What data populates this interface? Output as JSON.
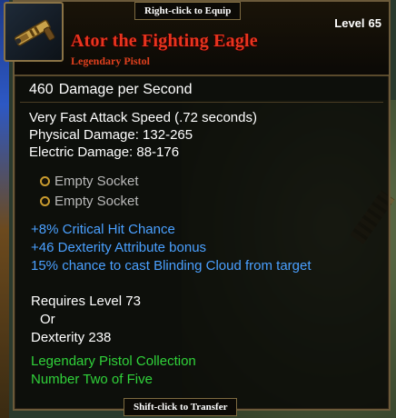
{
  "hints": {
    "equip": "Right-click to Equip",
    "transfer": "Shift-click to Transfer"
  },
  "item": {
    "icon": "pistol-icon",
    "name": "Ator the Fighting Eagle",
    "type": "Legendary Pistol",
    "level_label": "Level",
    "level_value": "65",
    "name_color": "#e8341e"
  },
  "dps": {
    "value": "460",
    "label": "Damage per Second"
  },
  "stats": [
    "Very Fast Attack Speed (.72 seconds)",
    "Physical Damage: 132-265",
    "Electric Damage: 88-176"
  ],
  "sockets": [
    {
      "label": "Empty Socket"
    },
    {
      "label": "Empty Socket"
    }
  ],
  "affixes": {
    "color": "#4aa0ff",
    "lines": [
      "+8% Critical Hit Chance",
      "+46 Dexterity Attribute bonus",
      "15% chance to cast Blinding Cloud from target"
    ]
  },
  "requirements": {
    "line1": "Requires Level 73",
    "or": "Or",
    "line2": "Dexterity 238"
  },
  "set": {
    "color": "#30d23a",
    "name": "Legendary Pistol Collection",
    "part": "Number Two of Five"
  }
}
